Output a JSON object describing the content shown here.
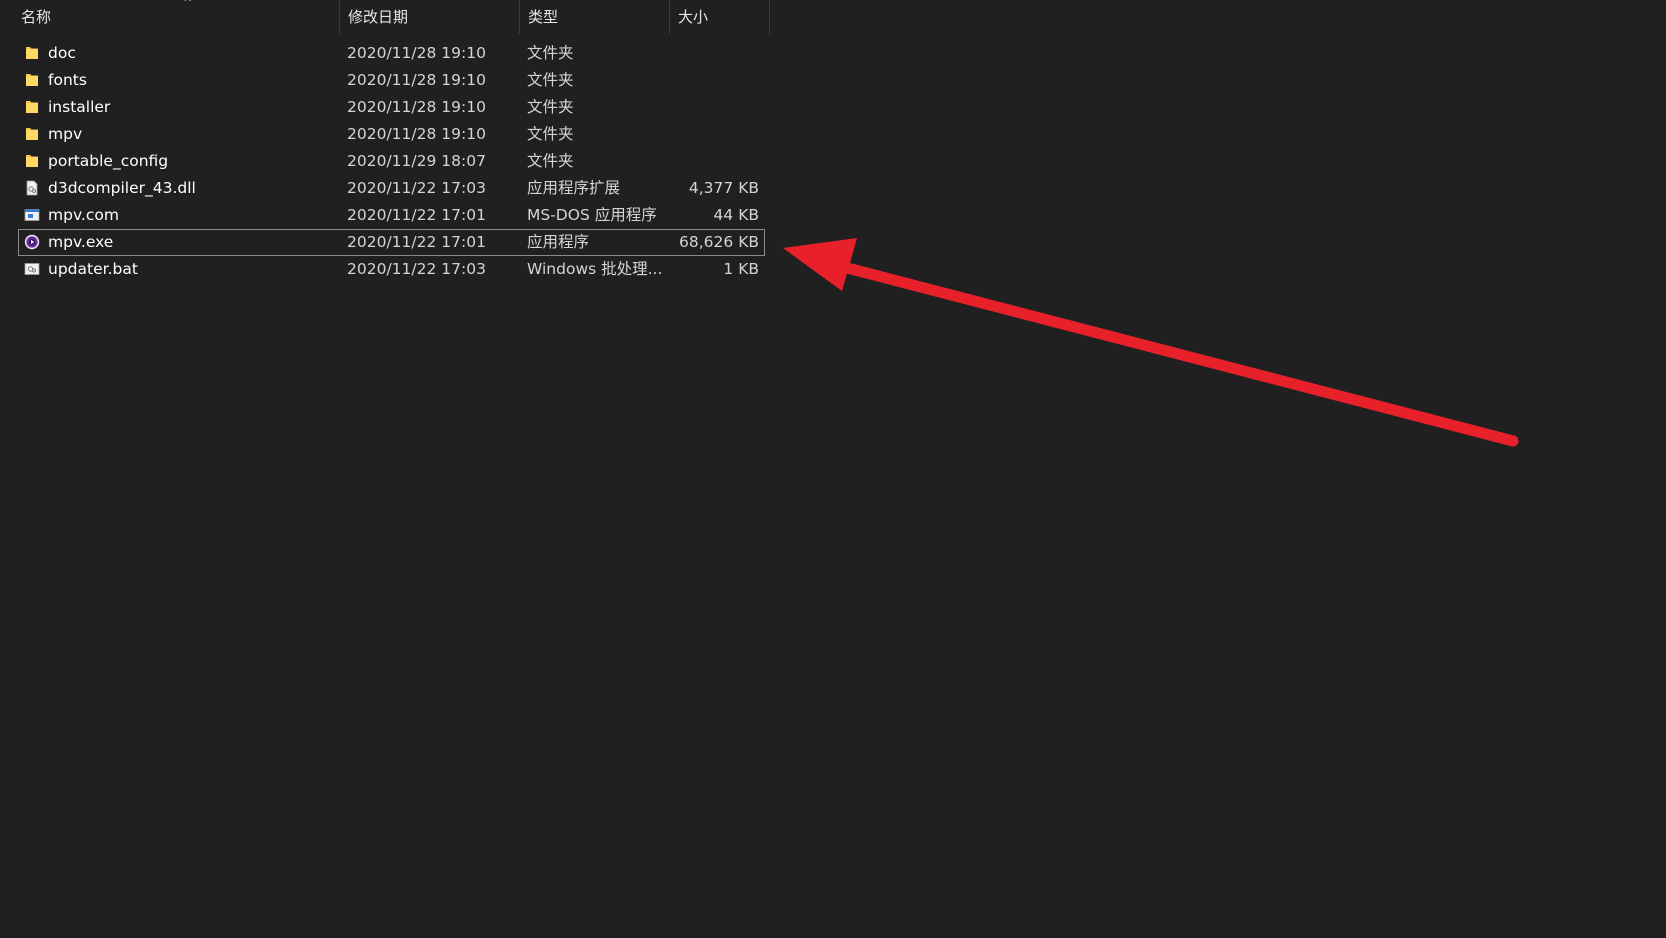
{
  "columns": {
    "name": "名称",
    "date": "修改日期",
    "type": "类型",
    "size": "大小"
  },
  "sort_indicator": "^",
  "files": [
    {
      "name": "doc",
      "date": "2020/11/28 19:10",
      "type": "文件夹",
      "size": "",
      "icon": "folder-icon"
    },
    {
      "name": "fonts",
      "date": "2020/11/28 19:10",
      "type": "文件夹",
      "size": "",
      "icon": "folder-icon"
    },
    {
      "name": "installer",
      "date": "2020/11/28 19:10",
      "type": "文件夹",
      "size": "",
      "icon": "folder-icon"
    },
    {
      "name": "mpv",
      "date": "2020/11/28 19:10",
      "type": "文件夹",
      "size": "",
      "icon": "folder-icon"
    },
    {
      "name": "portable_config",
      "date": "2020/11/29 18:07",
      "type": "文件夹",
      "size": "",
      "icon": "folder-icon"
    },
    {
      "name": "d3dcompiler_43.dll",
      "date": "2020/11/22 17:03",
      "type": "应用程序扩展",
      "size": "4,377 KB",
      "icon": "dll-file-icon"
    },
    {
      "name": "mpv.com",
      "date": "2020/11/22 17:01",
      "type": "MS-DOS 应用程序",
      "size": "44 KB",
      "icon": "dos-app-icon"
    },
    {
      "name": "mpv.exe",
      "date": "2020/11/22 17:01",
      "type": "应用程序",
      "size": "68,626 KB",
      "icon": "mpv-app-icon",
      "selected": true
    },
    {
      "name": "updater.bat",
      "date": "2020/11/22 17:03",
      "type": "Windows 批处理...",
      "size": "1 KB",
      "icon": "batch-file-icon"
    }
  ],
  "colors": {
    "background": "#202020",
    "folder": "#f4c64d",
    "arrow": "#e8202a",
    "mpv_icon": "#6b2fa0"
  }
}
